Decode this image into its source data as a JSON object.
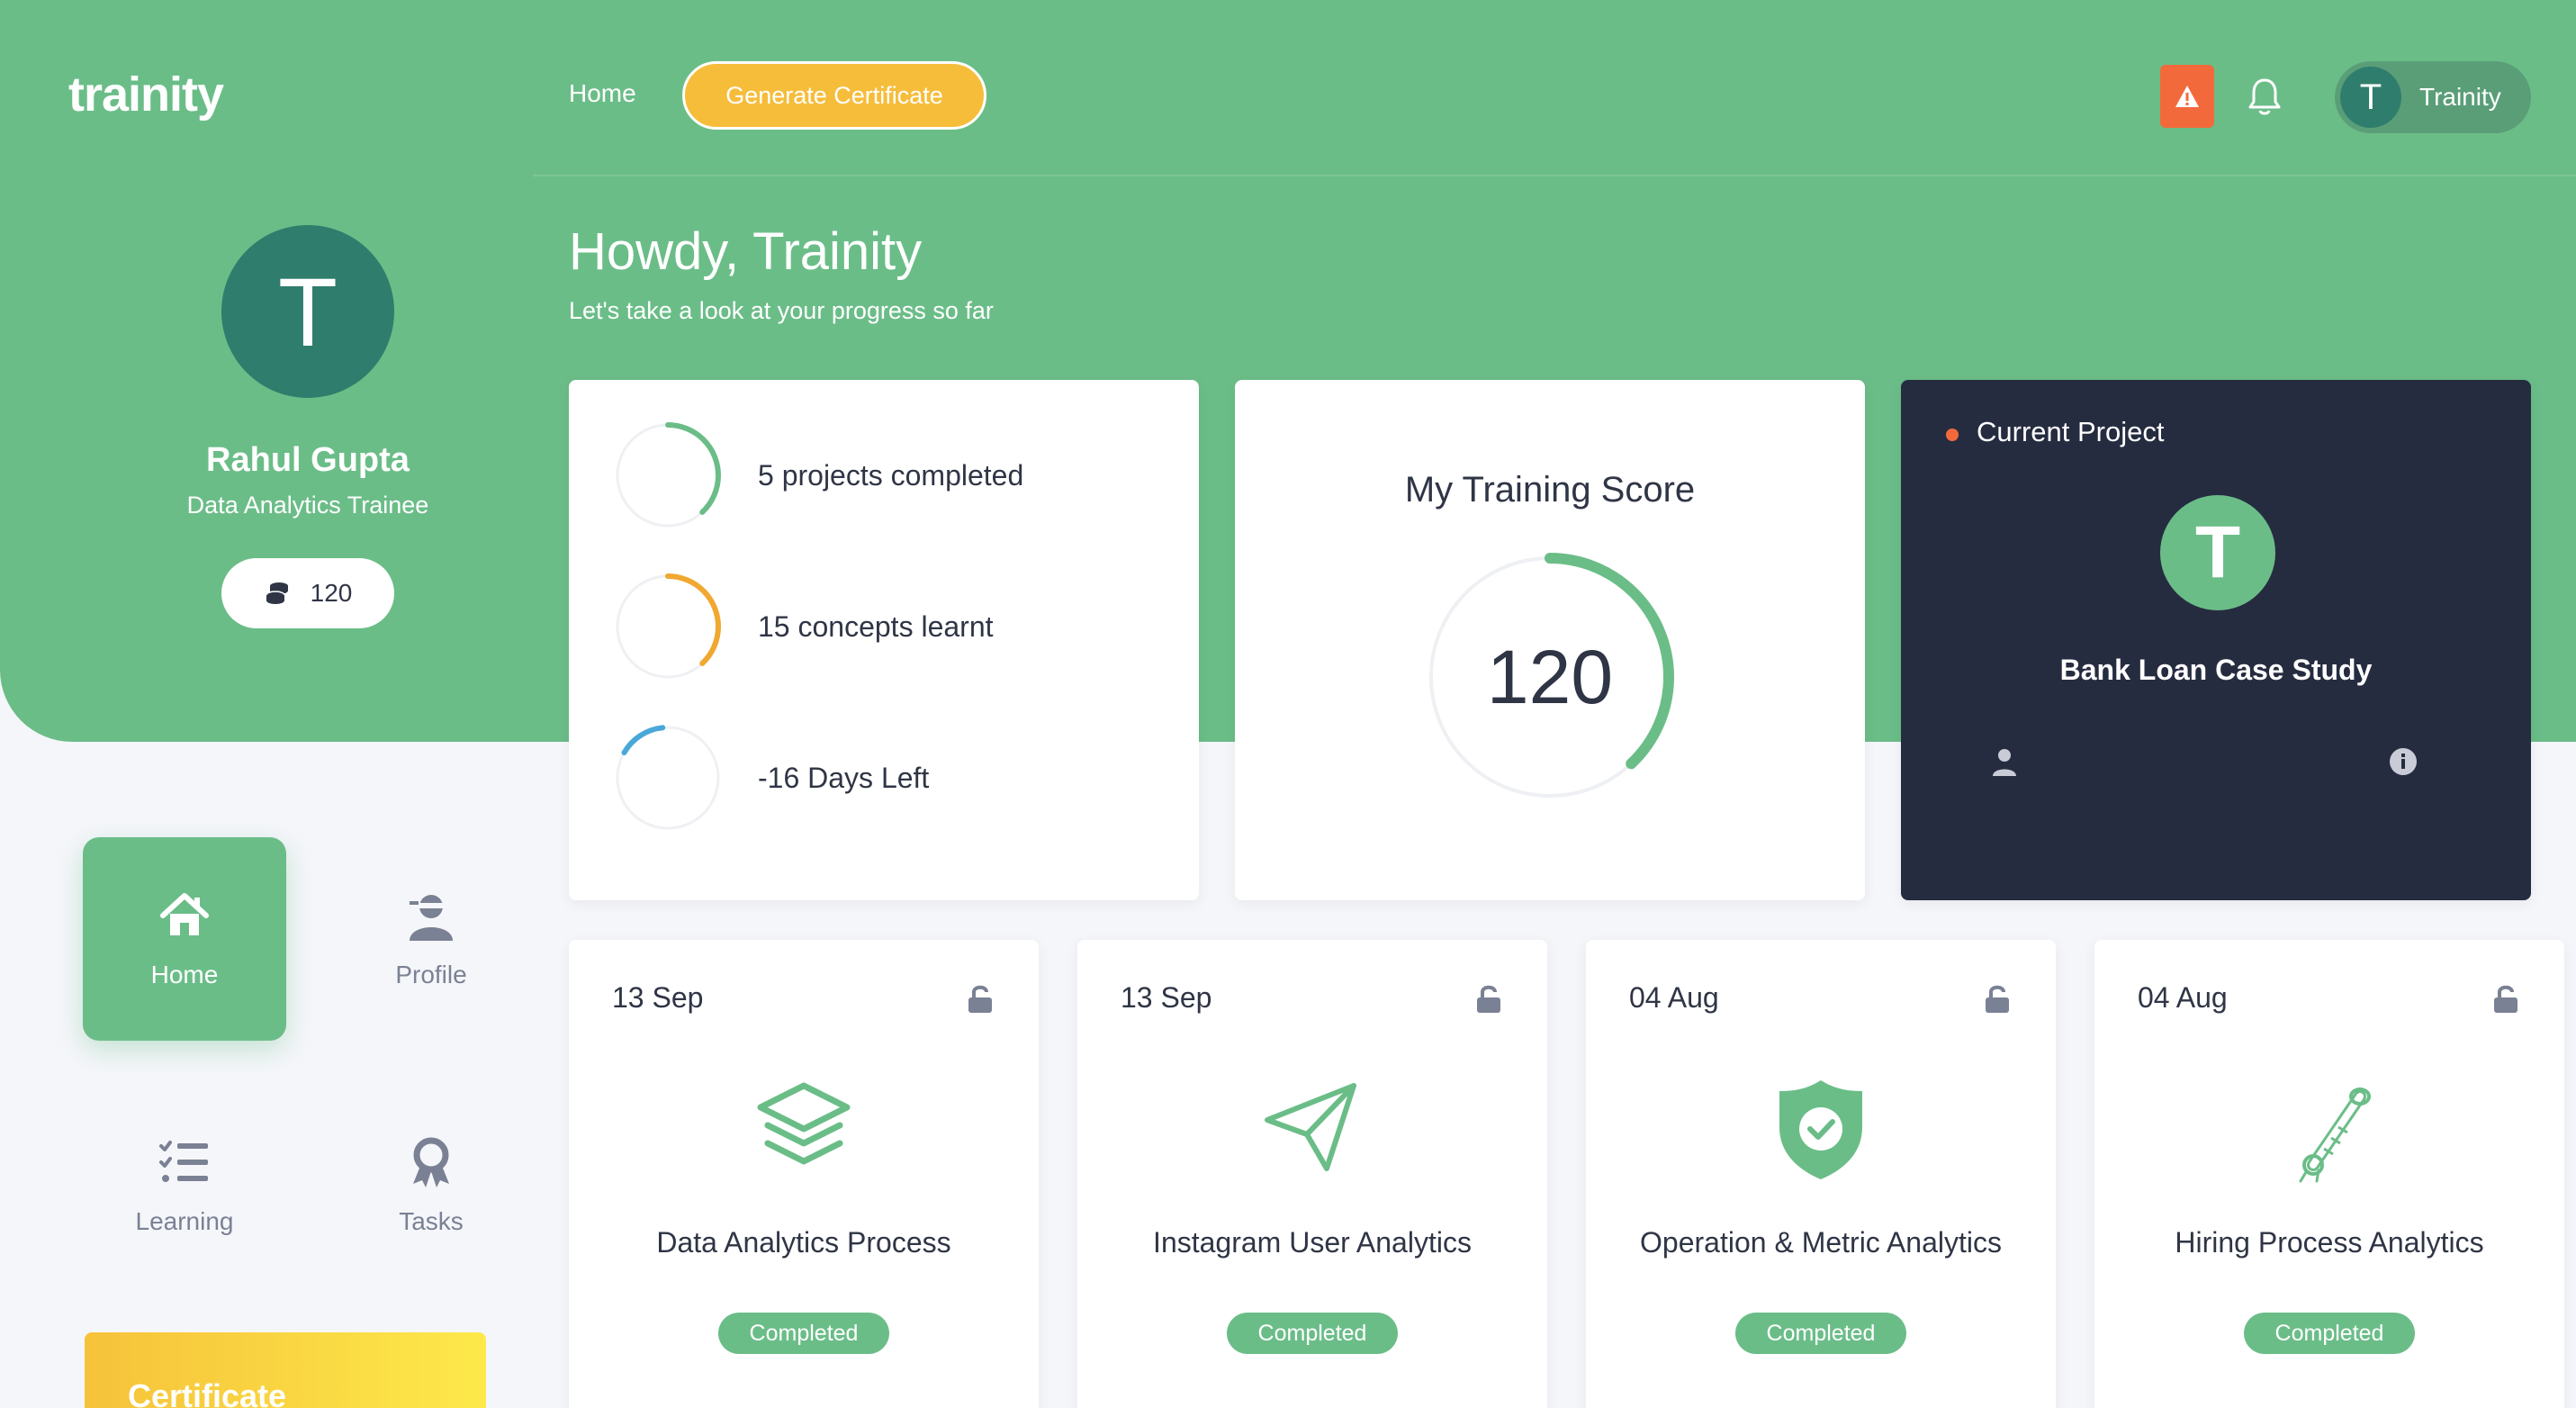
{
  "brand": "trainity",
  "topbar": {
    "home_label": "Home",
    "generate_certificate_label": "Generate Certificate",
    "user_initial": "T",
    "user_name": "Trainity"
  },
  "profile": {
    "initial": "T",
    "name": "Rahul Gupta",
    "role": "Data Analytics Trainee",
    "coins": "120"
  },
  "greeting": {
    "title": "Howdy, Trainity",
    "subtitle": "Let's take a look at your progress so far"
  },
  "stats": [
    {
      "label": "5 projects completed",
      "color": "#6bbd88",
      "progress": 0.38
    },
    {
      "label": "15 concepts learnt",
      "color": "#f0a830",
      "progress": 0.38
    },
    {
      "label": "-16 Days Left",
      "color": "#4aa8d8",
      "progress": 0.15
    }
  ],
  "score": {
    "title": "My Training Score",
    "value": "120",
    "progress": 0.38,
    "color": "#6bbd88"
  },
  "current_project": {
    "label": "Current Project",
    "logo_initial": "T",
    "name": "Bank Loan Case Study"
  },
  "nav": {
    "home": "Home",
    "profile": "Profile",
    "learning": "Learning",
    "tasks": "Tasks"
  },
  "certificate_banner": "Certificate",
  "tasks": [
    {
      "date": "13 Sep",
      "title": "Data Analytics Process",
      "status": "Completed",
      "icon": "layers-icon"
    },
    {
      "date": "13 Sep",
      "title": "Instagram User Analytics",
      "status": "Completed",
      "icon": "paper-plane-icon"
    },
    {
      "date": "04 Aug",
      "title": "Operation & Metric Analytics",
      "status": "Completed",
      "icon": "shield-check-icon"
    },
    {
      "date": "04 Aug",
      "title": "Hiring Process Analytics",
      "status": "Completed",
      "icon": "diploma-icon"
    }
  ],
  "colors": {
    "primary_green": "#6bbd88",
    "dark_panel": "#262c40",
    "accent_yellow": "#f6bd3b",
    "alert_orange": "#f26a3c"
  }
}
